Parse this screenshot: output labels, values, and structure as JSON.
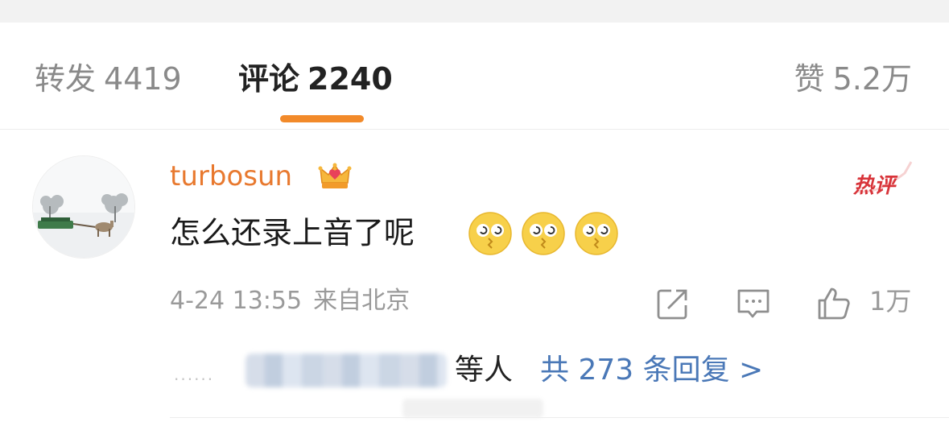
{
  "tabs": {
    "repost": {
      "label": "转发",
      "count": "4419"
    },
    "comments": {
      "label": "评论",
      "count": "2240"
    },
    "likes": {
      "label": "赞",
      "count": "5.2万"
    }
  },
  "comment": {
    "username": "turbosun",
    "hot_badge": "热评",
    "text": "怎么还录上音了呢",
    "emojis": [
      "dizzy-face-emoji",
      "dizzy-face-emoji",
      "dizzy-face-emoji"
    ],
    "timestamp": "4-24 13:55",
    "location": "来自北京",
    "like_count": "1万",
    "replies": {
      "dots": "······",
      "others_suffix": "等人",
      "total_label": "共 273 条回复 >"
    }
  },
  "colors": {
    "accent_orange": "#f28a2a",
    "username_orange": "#e8792f",
    "link_blue": "#4a78b7",
    "hot_red": "#d8343a"
  },
  "icons": [
    "crown-icon",
    "share-icon",
    "comment-icon",
    "thumbs-up-icon"
  ]
}
